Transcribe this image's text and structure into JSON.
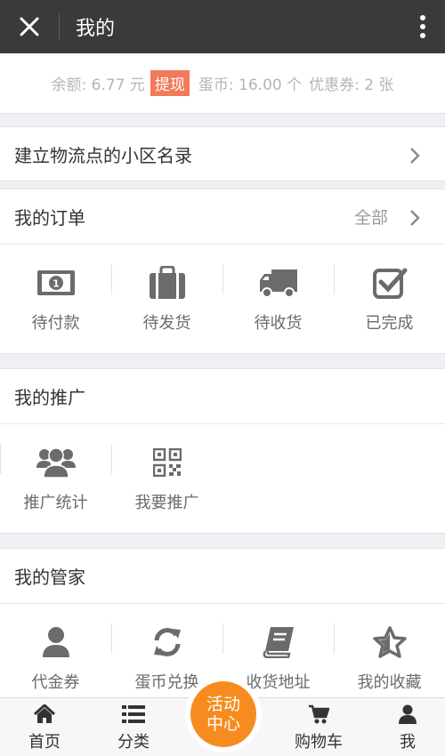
{
  "header": {
    "title": "我的"
  },
  "balance": {
    "balance_text": "余额: 6.77 元",
    "withdraw_label": "提现",
    "coins_text": "蛋币: 16.00 个",
    "coupons_text": "优惠券: 2 张"
  },
  "community_link": {
    "label": "建立物流点的小区名录"
  },
  "orders": {
    "title": "我的订单",
    "all_label": "全部",
    "items": [
      {
        "label": "待付款",
        "icon": "cash-icon"
      },
      {
        "label": "待发货",
        "icon": "briefcase-icon"
      },
      {
        "label": "待收货",
        "icon": "truck-icon"
      },
      {
        "label": "已完成",
        "icon": "checkbox-icon"
      }
    ]
  },
  "promotion": {
    "title": "我的推广",
    "items": [
      {
        "label": "推广统计",
        "icon": "users-icon"
      },
      {
        "label": "我要推广",
        "icon": "qrcode-icon"
      }
    ]
  },
  "butler": {
    "title": "我的管家",
    "items": [
      {
        "label": "代金券",
        "icon": "user-icon"
      },
      {
        "label": "蛋币兑换",
        "icon": "refresh-icon"
      },
      {
        "label": "收货地址",
        "icon": "book-icon"
      },
      {
        "label": "我的收藏",
        "icon": "star-icon"
      }
    ]
  },
  "tabbar": {
    "items": [
      {
        "label": "首页",
        "icon": "home-icon"
      },
      {
        "label": "分类",
        "icon": "list-icon"
      },
      {
        "label": "购物车",
        "icon": "cart-icon"
      },
      {
        "label": "我",
        "icon": "user-icon"
      }
    ],
    "activity_line1": "活动",
    "activity_line2": "中心"
  },
  "colors": {
    "topbar": "#3a3a3c",
    "accent_orange": "#f68c1f",
    "withdraw_red": "#f17a5a",
    "icon_gray": "#6b6b6b"
  }
}
